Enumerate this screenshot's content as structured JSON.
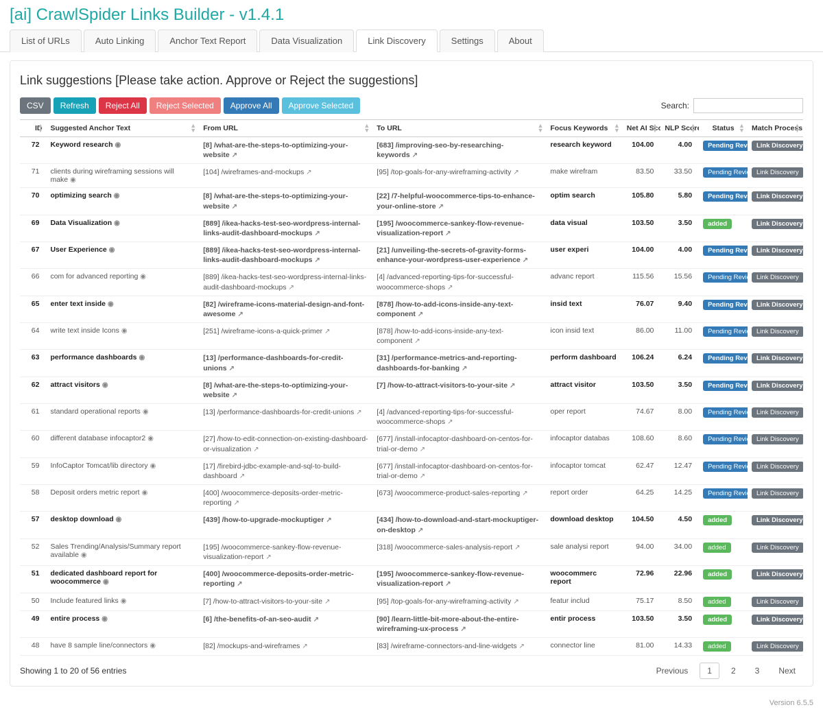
{
  "app_title": "[ai] CrawlSpider Links Builder - v1.4.1",
  "tabs": [
    {
      "label": "List of URLs"
    },
    {
      "label": "Auto Linking"
    },
    {
      "label": "Anchor Text Report"
    },
    {
      "label": "Data Visualization"
    },
    {
      "label": "Link Discovery",
      "active": true
    },
    {
      "label": "Settings"
    },
    {
      "label": "About"
    }
  ],
  "panel_heading": "Link suggestions [Please take action. Approve or Reject the suggestions]",
  "toolbar": {
    "csv": "CSV",
    "refresh": "Refresh",
    "reject_all": "Reject All",
    "reject_selected": "Reject Selected",
    "approve_all": "Approve All",
    "approve_selected": "Approve Selected"
  },
  "search_label": "Search:",
  "columns": {
    "id": "ID",
    "anchor": "Suggested Anchor Text",
    "from": "From URL",
    "to": "To URL",
    "keywords": "Focus Keywords",
    "netai": "Net AI Score",
    "nlp": "NLP Score",
    "status": "Status",
    "process": "Match Process"
  },
  "status_labels": {
    "pending": "Pending Review",
    "added": "added"
  },
  "process_label": "Link Discovery",
  "rows": [
    {
      "id": 72,
      "bold": true,
      "anchor": "Keyword research",
      "from": "[8] /what-are-the-steps-to-optimizing-your-website",
      "to": "[683] /improving-seo-by-researching-keywords",
      "keywords": "research keyword",
      "netai": "104.00",
      "nlp": "4.00",
      "status": "pending"
    },
    {
      "id": 71,
      "bold": false,
      "anchor": "clients during wireframing sessions will make",
      "from": "[104] /wireframes-and-mockups",
      "to": "[95] /top-goals-for-any-wireframing-activity",
      "keywords": "make wirefram",
      "netai": "83.50",
      "nlp": "33.50",
      "status": "pending"
    },
    {
      "id": 70,
      "bold": true,
      "anchor": "optimizing search",
      "from": "[8] /what-are-the-steps-to-optimizing-your-website",
      "to": "[22] /7-helpful-woocommerce-tips-to-enhance-your-online-store",
      "keywords": "optim search",
      "netai": "105.80",
      "nlp": "5.80",
      "status": "pending"
    },
    {
      "id": 69,
      "bold": true,
      "anchor": "Data Visualization",
      "from": "[889] /ikea-hacks-test-seo-wordpress-internal-links-audit-dashboard-mockups",
      "to": "[195] /woocommerce-sankey-flow-revenue-visualization-report",
      "keywords": "data visual",
      "netai": "103.50",
      "nlp": "3.50",
      "status": "added"
    },
    {
      "id": 67,
      "bold": true,
      "anchor": "User Experience",
      "from": "[889] /ikea-hacks-test-seo-wordpress-internal-links-audit-dashboard-mockups",
      "to": "[21] /unveiling-the-secrets-of-gravity-forms-enhance-your-wordpress-user-experience",
      "keywords": "user experi",
      "netai": "104.00",
      "nlp": "4.00",
      "status": "pending"
    },
    {
      "id": 66,
      "bold": false,
      "anchor": "com for advanced reporting",
      "from": "[889] /ikea-hacks-test-seo-wordpress-internal-links-audit-dashboard-mockups",
      "to": "[4] /advanced-reporting-tips-for-successful-woocommerce-shops",
      "keywords": "advanc report",
      "netai": "115.56",
      "nlp": "15.56",
      "status": "pending"
    },
    {
      "id": 65,
      "bold": true,
      "anchor": "enter text inside",
      "from": "[82] /wireframe-icons-material-design-and-font-awesome",
      "to": "[878] /how-to-add-icons-inside-any-text-component",
      "keywords": "insid text",
      "netai": "76.07",
      "nlp": "9.40",
      "status": "pending"
    },
    {
      "id": 64,
      "bold": false,
      "anchor": "write text inside Icons",
      "from": "[251] /wireframe-icons-a-quick-primer",
      "to": "[878] /how-to-add-icons-inside-any-text-component",
      "keywords": "icon insid text",
      "netai": "86.00",
      "nlp": "11.00",
      "status": "pending"
    },
    {
      "id": 63,
      "bold": true,
      "anchor": "performance dashboards",
      "from": "[13] /performance-dashboards-for-credit-unions",
      "to": "[31] /performance-metrics-and-reporting-dashboards-for-banking",
      "keywords": "perform dashboard",
      "netai": "106.24",
      "nlp": "6.24",
      "status": "pending"
    },
    {
      "id": 62,
      "bold": true,
      "anchor": "attract visitors",
      "from": "[8] /what-are-the-steps-to-optimizing-your-website",
      "to": "[7] /how-to-attract-visitors-to-your-site",
      "keywords": "attract visitor",
      "netai": "103.50",
      "nlp": "3.50",
      "status": "pending"
    },
    {
      "id": 61,
      "bold": false,
      "anchor": "standard operational reports",
      "from": "[13] /performance-dashboards-for-credit-unions",
      "to": "[4] /advanced-reporting-tips-for-successful-woocommerce-shops",
      "keywords": "oper report",
      "netai": "74.67",
      "nlp": "8.00",
      "status": "pending"
    },
    {
      "id": 60,
      "bold": false,
      "anchor": "different database infocaptor2",
      "from": "[27] /how-to-edit-connection-on-existing-dashboard-or-visualization",
      "to": "[677] /install-infocaptor-dashboard-on-centos-for-trial-or-demo",
      "keywords": "infocaptor databas",
      "netai": "108.60",
      "nlp": "8.60",
      "status": "pending"
    },
    {
      "id": 59,
      "bold": false,
      "anchor": "InfoCaptor Tomcat/lib directory",
      "from": "[17] /firebird-jdbc-example-and-sql-to-build-dashboard",
      "to": "[677] /install-infocaptor-dashboard-on-centos-for-trial-or-demo",
      "keywords": "infocaptor tomcat",
      "netai": "62.47",
      "nlp": "12.47",
      "status": "pending"
    },
    {
      "id": 58,
      "bold": false,
      "anchor": "Deposit orders metric report",
      "from": "[400] /woocommerce-deposits-order-metric-reporting",
      "to": "[673] /woocommerce-product-sales-reporting",
      "keywords": "report order",
      "netai": "64.25",
      "nlp": "14.25",
      "status": "pending"
    },
    {
      "id": 57,
      "bold": true,
      "anchor": "desktop download",
      "from": "[439] /how-to-upgrade-mockuptiger",
      "to": "[434] /how-to-download-and-start-mockuptiger-on-desktop",
      "keywords": "download desktop",
      "netai": "104.50",
      "nlp": "4.50",
      "status": "added"
    },
    {
      "id": 52,
      "bold": false,
      "anchor": "Sales Trending/Analysis/Summary report available",
      "from": "[195] /woocommerce-sankey-flow-revenue-visualization-report",
      "to": "[318] /woocommerce-sales-analysis-report",
      "keywords": "sale analysi report",
      "netai": "94.00",
      "nlp": "34.00",
      "status": "added"
    },
    {
      "id": 51,
      "bold": true,
      "anchor": "dedicated dashboard report for woocommerce",
      "from": "[400] /woocommerce-deposits-order-metric-reporting",
      "to": "[195] /woocommerce-sankey-flow-revenue-visualization-report",
      "keywords": "woocommerc report",
      "netai": "72.96",
      "nlp": "22.96",
      "status": "added"
    },
    {
      "id": 50,
      "bold": false,
      "anchor": "Include featured links",
      "from": "[7] /how-to-attract-visitors-to-your-site",
      "to": "[95] /top-goals-for-any-wireframing-activity",
      "keywords": "featur includ",
      "netai": "75.17",
      "nlp": "8.50",
      "status": "added"
    },
    {
      "id": 49,
      "bold": true,
      "anchor": "entire process",
      "from": "[6] /the-benefits-of-an-seo-audit",
      "to": "[90] /learn-little-bit-more-about-the-entire-wireframing-ux-process",
      "keywords": "entir process",
      "netai": "103.50",
      "nlp": "3.50",
      "status": "added"
    },
    {
      "id": 48,
      "bold": false,
      "anchor": "have 8 sample line/connectors",
      "from": "[82] /mockups-and-wireframes",
      "to": "[83] /wireframe-connectors-and-line-widgets",
      "keywords": "connector line",
      "netai": "81.00",
      "nlp": "14.33",
      "status": "added"
    }
  ],
  "footer_info": "Showing 1 to 20 of 56 entries",
  "pager": {
    "previous": "Previous",
    "next": "Next",
    "pages": [
      "1",
      "2",
      "3"
    ],
    "active": "1"
  },
  "version": "Version 6.5.5"
}
